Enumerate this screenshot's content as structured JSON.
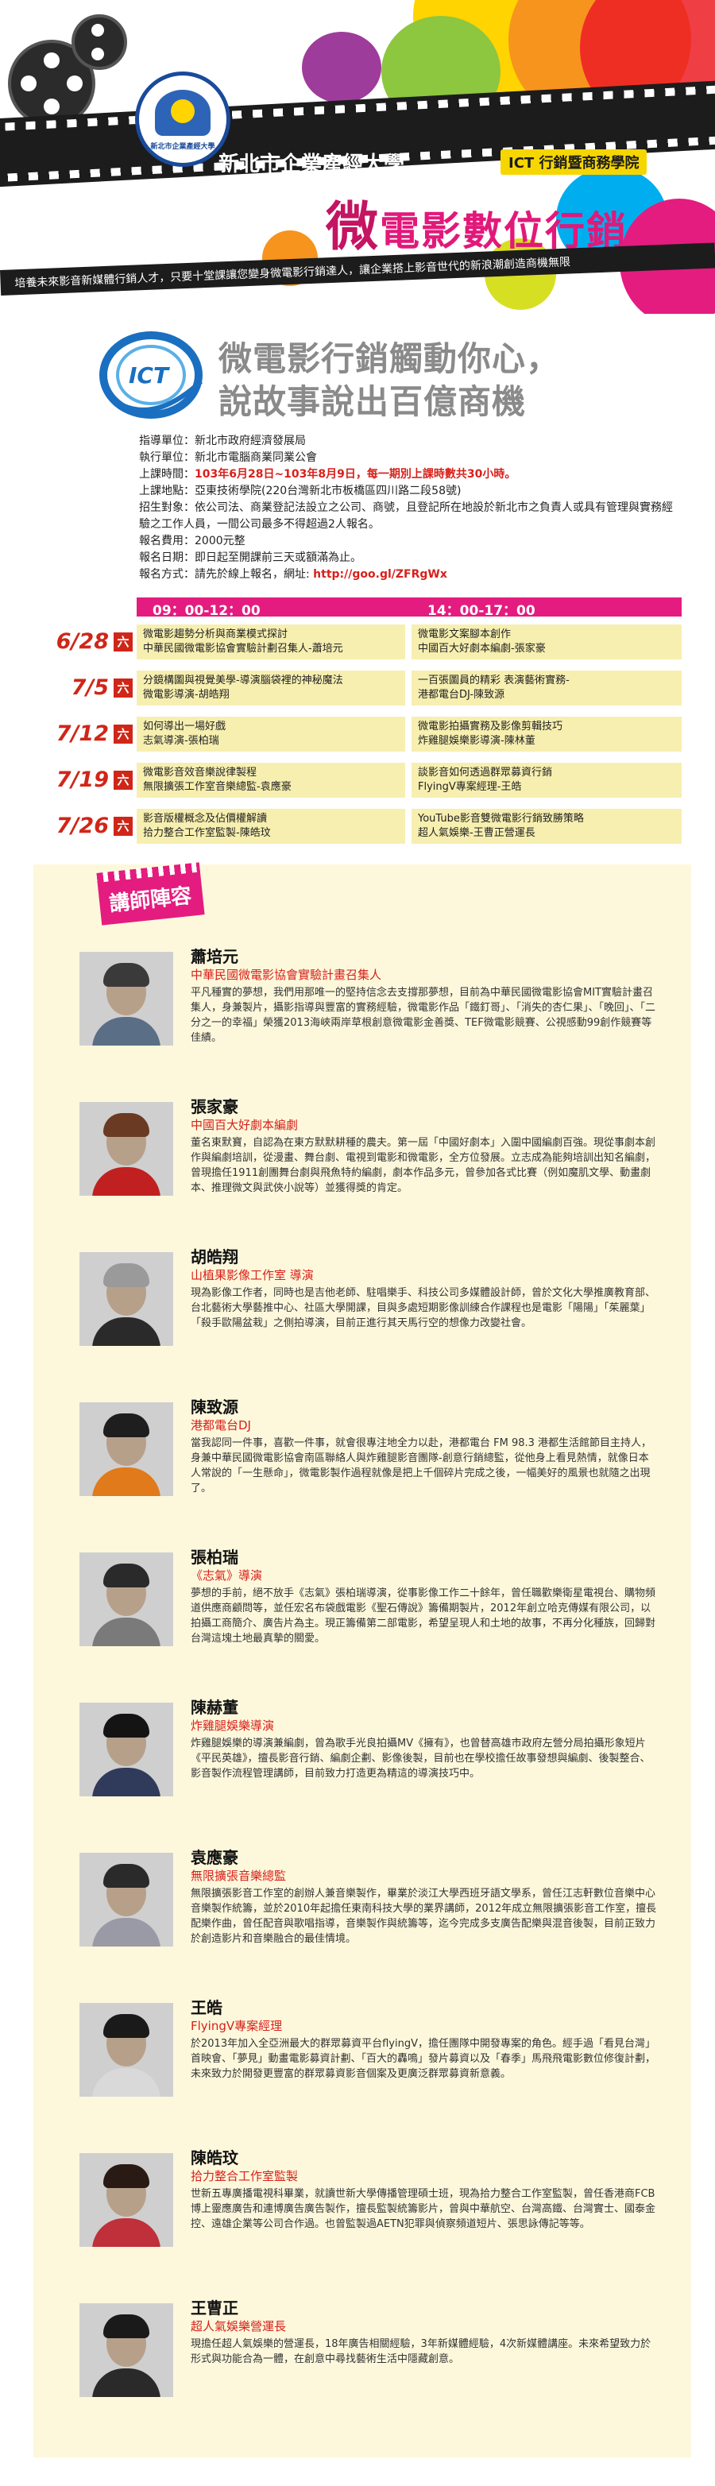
{
  "banner": {
    "university": "新北市企業產經大學",
    "ict_tag": "ICT 行銷暨商務學院",
    "title_big": "微",
    "title_rest": "電影數位行銷",
    "tagline": "培養未來影音新媒體行銷人才，只要十堂課讓您變身微電影行銷達人，讓企業搭上影音世代的新浪潮創造商機無限",
    "seal_text": "新北市企業產經大學",
    "colors": {
      "pink": "#e41c7f",
      "orange": "#f7941d",
      "yellow": "#ffd400",
      "green": "#8dc63f",
      "cyan": "#00aeef"
    }
  },
  "slogan": {
    "line1": "微電影行銷觸動你心，",
    "line2": "說故事說出百億商機",
    "logo_text": "ICT"
  },
  "info": {
    "guide": "指導單位：新北市政府經濟發展局",
    "exec": "執行單位：新北市電腦商業同業公會",
    "time_label": "上課時間：",
    "time_value": "103年6月28日~103年8月9日，每一期別上課時數共30小時。",
    "place": "上課地點：亞東技術學院(220台灣新北市板橋區四川路二段58號)",
    "target": "招生對象：依公司法、商業登記法設立之公司、商號，且登記所在地設於新北市之負責人或具有管理與實務經驗之工作人員，一間公司最多不得超過2人報名。",
    "fee": "報名費用：2000元整",
    "date": "報名日期：即日起至開課前三天或額滿為止。",
    "method_label": "報名方式：請先於線上報名，網址: ",
    "method_url": "http://goo.gl/ZFRgWx"
  },
  "schedule": {
    "head_morning": "09：00-12：00",
    "head_afternoon": "14：00-17：00",
    "day_marker": "六",
    "rows": [
      {
        "date": "6/28",
        "am": "微電影趨勢分析與商業模式探討\n中華民國微電影協會實驗計劃召集人-蕭培元",
        "pm": "微電影文案腳本創作\n中國百大好劇本編劇-張家豪"
      },
      {
        "date": "7/5",
        "am": "分鏡構圖與視覺美學-導演腦袋裡的神秘魔法\n微電影導演-胡皓翔",
        "pm": "一百張圖員的精彩 表演藝術實務-\n港都電台DJ-陳致源"
      },
      {
        "date": "7/12",
        "am": "如何導出一場好戲\n志氣導演-張柏瑞",
        "pm": "微電影拍攝實務及影像剪輯技巧\n炸雞腿娛樂影導演-陳林董"
      },
      {
        "date": "7/19",
        "am": "微電影音效音樂說律製程\n無限擴張工作室音樂總監-袁應豪",
        "pm": "談影音如何透過群眾募資行銷\nFlyingV專案經理-王皓"
      },
      {
        "date": "7/26",
        "am": "影音版權概念及佔價權解讀\n拾力整合工作室監製-陳皓玟",
        "pm": "YouTube影音雙微電影行銷致勝策略\n超人氣娛樂-王曹正營運長"
      }
    ]
  },
  "teachers_title": "講師陣容",
  "teachers": [
    {
      "name": "蕭培元",
      "role": "中華民國微電影協會實驗計畫召集人",
      "bio": "平凡種實的夢想，我們用那唯一的堅持信念去支撐那夢想，目前為中華民國微電影協會MIT實驗計畫召集人，身兼製片，攝影指導與豐富的實務經驗，微電影作品「鐵釘哥」、「消失的杏仁果」、「晚回」、「二分之一的幸福」榮獲2013海峽兩岸草根創意微電影金善獎、TEF微電影競賽、公視感動99創作競賽等佳績。",
      "hair": "#3a3a3a",
      "shirt": "#5a6e86"
    },
    {
      "name": "張家豪",
      "role": "中國百大好劇本編劇",
      "bio": "董名東默寶，自認為在東方默默耕種的農夫。第一屆「中國好劇本」入圍中國編劇百強。現從事劇本創作與編劇培訓，從漫畫、舞台劇、電視到電影和微電影，全方位發展。立志成為能夠培訓出知名編劇，曾現擔任1911創團舞台劇與飛魚特約編劇，劇本作品多元，曾參加各式比賽（例如魔肌文學、動畫劇本、推理微文與武俠小說等）並獲得獎的肯定。",
      "hair": "#6a3b22",
      "shirt": "#c02020"
    },
    {
      "name": "胡皓翔",
      "role": "山植果影像工作室 導演",
      "bio": "現為影像工作者，同時也是吉他老師、駐唱樂手、科技公司多媒體設計師，曾於文化大學推廣教育部、台北藝術大學藝推中心、社區大學開課，目與多處短期影像訓練合作課程也是電影「陽陽」「茱麗葉」「殺手歐陽盆栽」之側拍導演，目前正進行其天馬行空的想像力改變社會。",
      "hair": "#9a9a9a",
      "shirt": "#2a2a2a"
    },
    {
      "name": "陳致源",
      "role": "港都電台DJ",
      "bio": "當我認同一件事，喜歡一件事，就會很專注地全力以赴，港都電台 FM 98.3 港都生活館節目主持人，身兼中華民國微電影協會南區聯絡人與炸雞腿影音團隊-創意行銷總監，從他身上看見熱情，就像日本人常說的「一生懸命」，微電影製作過程就像是把上千個碎片完成之後，一幅美好的風景也就隨之出現了。",
      "hair": "#1e1e1e",
      "shirt": "#e07a1a"
    },
    {
      "name": "張柏瑞",
      "role": "《志氣》導演",
      "bio": "夢想的手前，絕不放手《志氣》張柏瑞導演，從事影像工作二十餘年，曾任職歡樂衛星電視台、購物頻道供應商顧問等，並任宏名布袋戲電影《聖石傳說》籌備期製片，2012年創立哈克傳媒有限公司，以拍攝工商簡介、廣告片為主。現正籌備第二部電影，希望呈現人和土地的故事，不再分化種族，回歸對台灣這塊土地最真摯的關愛。",
      "hair": "#2a2a2a",
      "shirt": "#7a7a7a"
    },
    {
      "name": "陳赫董",
      "role": "炸雞腿娛樂導演",
      "bio": "炸雞腿娛樂的導演兼編劇，曾為歌手光良拍攝MV《擁有》，也曾替高雄市政府左營分局拍攝形象短片《平民英雄》，擅長影音行銷、編劇企劃、影像後製，目前也在學校擔任故事發想與編劇、後製整合、影音製作流程管理講師，目前致力打造更為精這的導演技巧中。",
      "hair": "#141414",
      "shirt": "#303a5a"
    },
    {
      "name": "袁應豪",
      "role": "無限擴張音樂總監",
      "bio": "無限擴張影音工作室的創辦人兼音樂製作，畢業於淡江大學西班牙語文學系，曾任江志軒數位音樂中心音樂製作統籌，並於2010年起擔任東南科技大學的業界講師，2012年成立無限擴張影音工作室，擅長配樂作曲，曾任配音與歌唱指導，音樂製作與統籌等，迄今完成多支廣告配樂與混音後製，目前正致力於創造影片和音樂融合的最佳情境。",
      "hair": "#2a2a2a",
      "shirt": "#9a9aa6"
    },
    {
      "name": "王皓",
      "role": "FlyingV專案經理",
      "bio": "於2013年加入全亞洲最大的群眾募資平台flyingV，擔任團隊中開發專案的角色。經手過「看見台灣」首映會、「夢見」動畫電影募資計劃、「百大的轟鳴」發片募資以及「春季」馬飛飛電影數位修復計劃，未來致力於開發更豐富的群眾募資影音個案及更廣泛群眾募資新意義。",
      "hair": "#1a1a1a",
      "shirt": "#d9d9d9"
    },
    {
      "name": "陳皓玟",
      "role": "拾力整合工作室監製",
      "bio": "世新五專廣播電視科畢業，就讀世新大學傳播管理碩士班，現為拾力整合工作室監製，曾任香港商FCB博上靈應廣告和連博廣告廣告製作，擅長監製統籌影片，曾與中華航空、台灣高鐵、台灣實士、國泰金控、遠雄企業等公司合作過。也曾監製過AETN犯罪與偵察頻道短片、張思詠傳記等等。",
      "hair": "#2a1a14",
      "shirt": "#c0303a"
    },
    {
      "name": "王曹正",
      "role": "超人氣娛樂營運長",
      "bio": "現擔任超人氣娛樂的營運長，18年廣告相關經驗，3年新媒體經驗，4次新媒體講座。未來希望致力於形式與功能合為一體，在創意中尋找藝術生活中隱藏創意。",
      "hair": "#1a1a1a",
      "shirt": "#2a2a2a"
    }
  ]
}
